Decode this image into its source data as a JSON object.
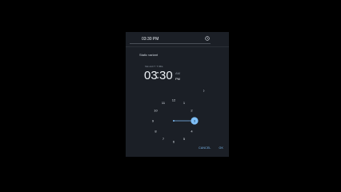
{
  "field": {
    "value": "03:30 PM"
  },
  "picker": {
    "variant_label": "Static variant",
    "select_label": "SELECT TIME",
    "hour": "03",
    "minute": "30",
    "am": "AM",
    "pm": "PM",
    "selected_period": "PM",
    "dial_numbers": [
      "12",
      "1",
      "2",
      "3",
      "4",
      "5",
      "6",
      "7",
      "8",
      "9",
      "10",
      "11"
    ],
    "selected_hour": "3"
  },
  "actions": {
    "cancel": "CANCEL",
    "ok": "OK"
  },
  "colors": {
    "accent": "#7fbff7",
    "surface": "#1b1f26",
    "text": "#eef2f6"
  }
}
